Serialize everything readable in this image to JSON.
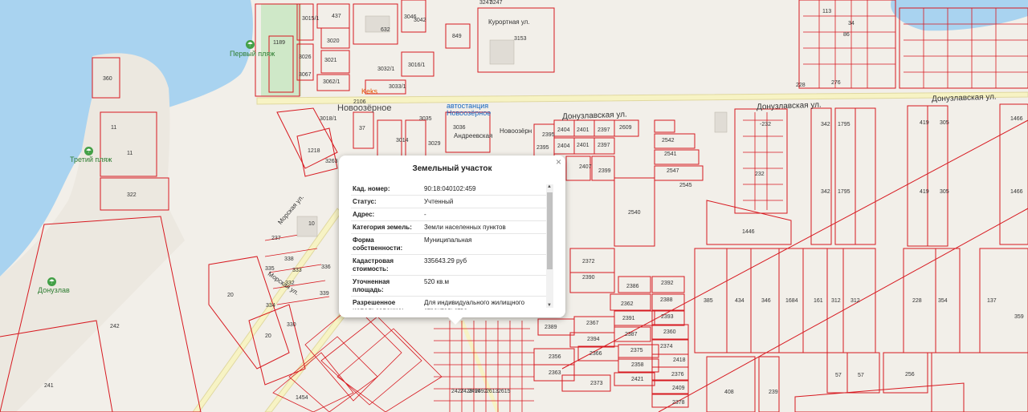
{
  "map": {
    "streets": {
      "donuzlav_1": "Донузлавская ул.",
      "donuzlav_2": "Донузлавская ул.",
      "donuzlav_3": "Донузлавская ул.",
      "kurortnaya": "Курортная ул.",
      "morskaya_1": "Морская ул.",
      "morskaya_2": "Морская ул.",
      "andreevskaya": "Андреевская"
    },
    "pois": {
      "first_beach": "Первый пляж",
      "third_beach": "Третий пляж",
      "donuzlav": "Донузлав",
      "keks": "Keks",
      "bus_station": "автостанция Новоозёрное",
      "town": "Новоозёрное",
      "town_2": "Новоозёрн"
    },
    "parcels": [
      "437",
      "632",
      "3020",
      "3021",
      "1189",
      "3015/1",
      "3026",
      "3067",
      "3046",
      "3042",
      "3247",
      "849",
      "3153",
      "3062/1",
      "3032/1",
      "3016/1",
      "3033/1",
      "2106",
      "360",
      "11",
      "11",
      "322",
      "3035",
      "3036",
      "3018/1",
      "37",
      "3014",
      "3029",
      "1218",
      "3263",
      "2395",
      "2404",
      "2401",
      "2397",
      "2609",
      "2395",
      "2404",
      "2401",
      "2397",
      "2542",
      "2541",
      "2547",
      "2545",
      "2407",
      "2399",
      "-232",
      "232",
      "342",
      "1795",
      "419",
      "305",
      "1466",
      "342",
      "1795",
      "419",
      "305",
      "1466",
      "2540",
      "1446",
      "2372",
      "2390",
      "2386",
      "2392",
      "2362",
      "2388",
      "2391",
      "2393",
      "2389",
      "2367",
      "2387",
      "2360",
      "2394",
      "2374",
      "2356",
      "2366",
      "2375",
      "2418",
      "2363",
      "2358",
      "2376",
      "2373",
      "2421",
      "2409",
      "2378",
      "385",
      "434",
      "346",
      "1684",
      "161",
      "312",
      "312",
      "228",
      "354",
      "137",
      "359",
      "20",
      "242",
      "20",
      "241",
      "1454",
      "237",
      "338",
      "333",
      "335",
      "334",
      "332",
      "336",
      "330",
      "339",
      "10",
      "57",
      "57",
      "256",
      "408",
      "239",
      "113",
      "34",
      "86",
      "228",
      "276",
      "2427",
      "2428",
      "2490",
      "2492",
      "2613",
      "2615",
      "3247"
    ],
    "attribution": "",
    "zoom": ""
  },
  "popup": {
    "title": "Земельный участок",
    "close": "×",
    "rows": [
      {
        "key": "Кад. номер:",
        "value": "90:18:040102:459"
      },
      {
        "key": "Статус:",
        "value": "Учтенный"
      },
      {
        "key": "Адрес:",
        "value": "-"
      },
      {
        "key": "Категория земель:",
        "value": "Земли населенных пунктов"
      },
      {
        "key": "Форма собственности:",
        "value": "Муниципальная"
      },
      {
        "key": "Кадастровая стоимость:",
        "value": "335643.29 руб"
      },
      {
        "key": "Уточненная площадь:",
        "value": "520 кв.м"
      },
      {
        "key": "Разрешенное использование:",
        "value": "Для индивидуального жилищного строительства"
      }
    ]
  },
  "colors": {
    "water": "#a9d3f0",
    "land": "#f2efe9",
    "parcel": "#d71920",
    "road": "#fdfbe6",
    "park": "#c8e6c9"
  }
}
